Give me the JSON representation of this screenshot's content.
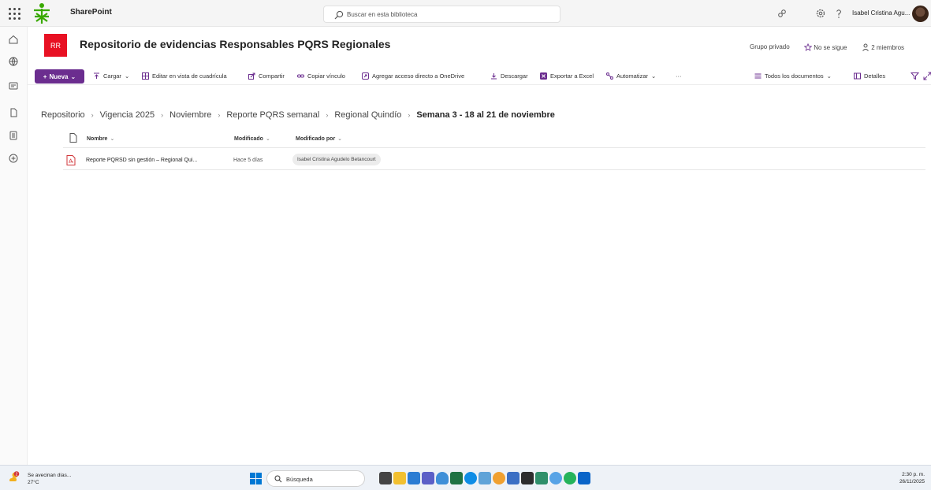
{
  "suite": {
    "app_name": "SharePoint",
    "search_placeholder": "Buscar en esta biblioteca",
    "user_name": "Isabel Cristina Agu..."
  },
  "site": {
    "tile_initials": "RR",
    "title": "Repositorio de evidencias Responsables PQRS Regionales",
    "privacy": "Grupo privado",
    "follow": "No se sigue",
    "members": "2 miembros"
  },
  "command_bar": {
    "new": "Nueva",
    "upload": "Cargar",
    "grid_edit": "Editar en vista de cuadrícula",
    "share": "Compartir",
    "copy_link": "Copiar vínculo",
    "shortcut": "Agregar acceso directo a OneDrive",
    "download": "Descargar",
    "export_excel": "Exportar a Excel",
    "automate": "Automatizar",
    "more": "···",
    "view": "Todos los documentos",
    "details": "Detalles"
  },
  "breadcrumb": {
    "items": [
      "Repositorio",
      "Vigencia 2025",
      "Noviembre",
      "Reporte PQRS semanal",
      "Regional Quindío"
    ],
    "current": "Semana 3 - 18 al 21 de noviembre"
  },
  "table": {
    "columns": {
      "name": "Nombre",
      "modified": "Modificado",
      "modified_by": "Modificado por"
    },
    "rows": [
      {
        "name": "Reporte PQRSD sin gestión – Regional Qui...",
        "modified": "Hace 5 días",
        "modified_by": "Isabel Cristina Agudelo Betancourt"
      }
    ]
  },
  "taskbar": {
    "weather_text": "Se avecinan días...",
    "weather_temp": "27°C",
    "weather_badge": "2",
    "search": "Búsqueda",
    "time": "2:30 p. m.",
    "date": "26/11/2025"
  },
  "colors": {
    "accent_purple": "#6b2d8f",
    "site_tile_red": "#e81123",
    "logo_green": "#39a900"
  }
}
